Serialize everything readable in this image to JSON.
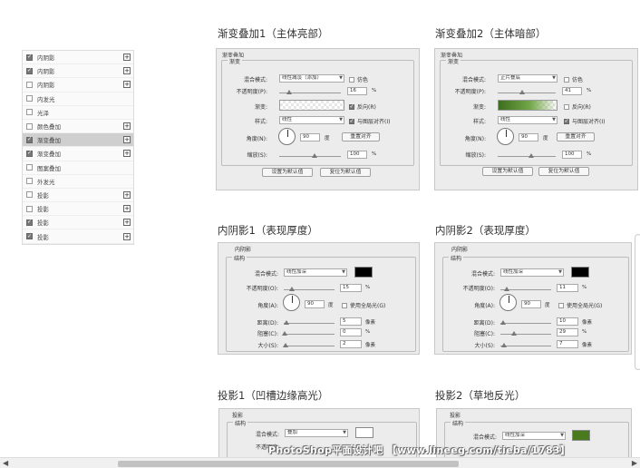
{
  "layers": [
    {
      "label": "内阴影",
      "checked": true,
      "plus": true
    },
    {
      "label": "内阴影",
      "checked": true,
      "plus": true
    },
    {
      "label": "内阴影",
      "checked": false,
      "plus": true
    },
    {
      "label": "内发光",
      "checked": false,
      "plus": false
    },
    {
      "label": "光泽",
      "checked": false,
      "plus": false
    },
    {
      "label": "颜色叠加",
      "checked": false,
      "plus": true
    },
    {
      "label": "渐变叠加",
      "checked": true,
      "plus": true,
      "selected": true
    },
    {
      "label": "渐变叠加",
      "checked": true,
      "plus": true
    },
    {
      "label": "图案叠加",
      "checked": false,
      "plus": false
    },
    {
      "label": "外发光",
      "checked": false,
      "plus": false
    },
    {
      "label": "投影",
      "checked": false,
      "plus": true
    },
    {
      "label": "投影",
      "checked": false,
      "plus": true
    },
    {
      "label": "投影",
      "checked": true,
      "plus": true
    },
    {
      "label": "投影",
      "checked": true,
      "plus": true
    }
  ],
  "grad1": {
    "title": "渐变叠加1（主体亮部）",
    "header": "渐变叠加",
    "legend": "渐变",
    "blend_label": "混合模式:",
    "blend_value": "线性减淡（添加）",
    "dither_label": "仿色",
    "opacity_label": "不透明度(P):",
    "opacity_value": "16",
    "opacity_unit": "%",
    "gradient_label": "渐变:",
    "reverse_label": "反向(R)",
    "style_label": "样式:",
    "style_value": "线性",
    "align_label": "与图层对齐(I)",
    "angle_label": "角度(N):",
    "angle_value": "90",
    "angle_unit": "度",
    "reset_align": "重置对齐",
    "scale_label": "缩放(S):",
    "scale_value": "100",
    "scale_unit": "%",
    "btn_default": "设置为默认值",
    "btn_reset": "复位为默认值"
  },
  "grad2": {
    "title": "渐变叠加2（主体暗部）",
    "header": "渐变叠加",
    "legend": "渐变",
    "blend_label": "混合模式:",
    "blend_value": "正片叠底",
    "dither_label": "仿色",
    "opacity_label": "不透明度(P):",
    "opacity_value": "41",
    "opacity_unit": "%",
    "gradient_label": "渐变:",
    "reverse_label": "反向(R)",
    "style_label": "样式:",
    "style_value": "线性",
    "align_label": "与图层对齐(I)",
    "angle_label": "角度(N):",
    "angle_value": "90",
    "angle_unit": "度",
    "reset_align": "重置对齐",
    "scale_label": "缩放(S):",
    "scale_value": "100",
    "scale_unit": "%",
    "btn_default": "设置为默认值",
    "btn_reset": "复位为默认值"
  },
  "inner1": {
    "title": "内阴影1（表现厚度）",
    "header": "内阴影",
    "legend": "结构",
    "blend_label": "混合模式:",
    "blend_value": "线性加深",
    "color": "#000000",
    "opacity_label": "不透明度(O):",
    "opacity_value": "15",
    "opacity_unit": "%",
    "angle_label": "角度(A):",
    "angle_value": "90",
    "angle_unit": "度",
    "global_light": "使用全局光(G)",
    "distance_label": "距离(D):",
    "distance_value": "5",
    "distance_unit": "像素",
    "choke_label": "阻塞(C):",
    "choke_value": "0",
    "choke_unit": "%",
    "size_label": "大小(S):",
    "size_value": "2",
    "size_unit": "像素"
  },
  "inner2": {
    "title": "内阴影2（表现厚度）",
    "header": "内阴影",
    "legend": "结构",
    "blend_label": "混合模式:",
    "blend_value": "线性加深",
    "color": "#000000",
    "opacity_label": "不透明度(O):",
    "opacity_value": "11",
    "opacity_unit": "%",
    "angle_label": "角度(A):",
    "angle_value": "90",
    "angle_unit": "度",
    "global_light": "使用全局光(G)",
    "distance_label": "距离(D):",
    "distance_value": "10",
    "distance_unit": "像素",
    "choke_label": "阻塞(C):",
    "choke_value": "29",
    "choke_unit": "%",
    "size_label": "大小(S):",
    "size_value": "7",
    "size_unit": "像素"
  },
  "shadow1": {
    "title": "投影1（凹槽边缘高光）",
    "header": "投影",
    "legend": "结构",
    "blend_label": "混合模式:",
    "blend_value": "叠加",
    "color": "#ffffff",
    "opacity_label": "不透明度:"
  },
  "shadow2": {
    "title": "投影2（草地反光）",
    "header": "投影",
    "legend": "结构",
    "blend_label": "混合模式:",
    "blend_value": "线性加深",
    "color": "#4a7a1e"
  },
  "watermark": "PhotoShop平面设计吧 【www.lineeg.com/tieba/1783】",
  "scroll": {
    "left_arrow": "◀",
    "right_arrow": "▶"
  }
}
